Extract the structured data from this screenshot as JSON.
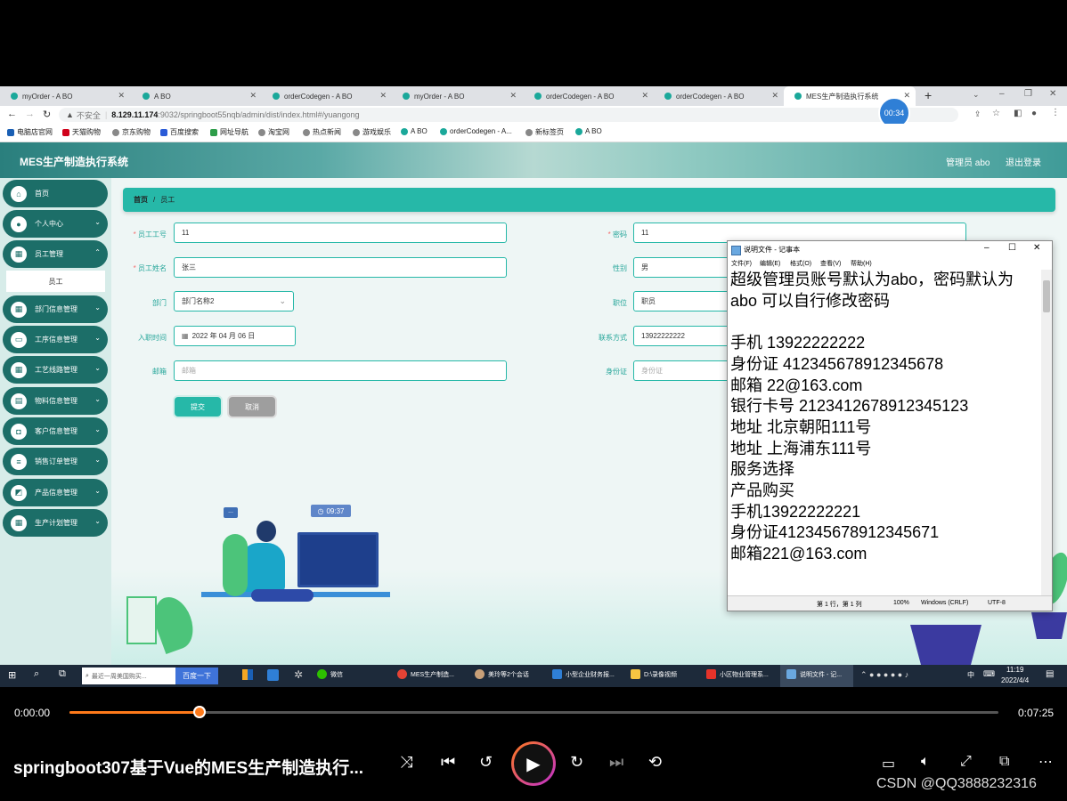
{
  "browser": {
    "tabs": [
      {
        "label": "myOrder - A BO"
      },
      {
        "label": "A BO"
      },
      {
        "label": "orderCodegen - A BO"
      },
      {
        "label": "myOrder - A BO"
      },
      {
        "label": "orderCodegen - A BO"
      },
      {
        "label": "orderCodegen - A BO"
      },
      {
        "label": "MES生产制造执行系统"
      }
    ],
    "new_tab": "+",
    "not_secure": "不安全",
    "url_host": "8.129.11.174",
    "url_rest": ":9032/springboot55nqb/admin/dist/index.html#/yuangong",
    "timer_badge": "00:34",
    "bookmarks": [
      "电脑店官网",
      "天猫购物",
      "京东购物",
      "百度搜索",
      "网址导航",
      "淘宝网",
      "热点新闻",
      "游戏娱乐",
      "A BO",
      "orderCodegen - A...",
      "新标签页",
      "A BO"
    ]
  },
  "app": {
    "title": "MES生产制造执行系统",
    "admin_label": "管理员 abo",
    "logout": "退出登录",
    "sidebar": {
      "items": [
        {
          "label": "首页",
          "icon": "home-icon",
          "glyph": "⌂"
        },
        {
          "label": "个人中心",
          "icon": "user-icon",
          "glyph": "●"
        },
        {
          "label": "员工管理",
          "icon": "grid-icon",
          "glyph": "▦"
        },
        {
          "label": "部门信息管理",
          "icon": "grid-icon",
          "glyph": "▦"
        },
        {
          "label": "工序信息管理",
          "icon": "monitor-icon",
          "glyph": "▭"
        },
        {
          "label": "工艺线路管理",
          "icon": "grid-icon",
          "glyph": "▦"
        },
        {
          "label": "物料信息管理",
          "icon": "clipboard-icon",
          "glyph": "▤"
        },
        {
          "label": "客户信息管理",
          "icon": "box-icon",
          "glyph": "◘"
        },
        {
          "label": "销售订单管理",
          "icon": "list-icon",
          "glyph": "≡"
        },
        {
          "label": "产品信息管理",
          "icon": "chart-icon",
          "glyph": "◩"
        },
        {
          "label": "生产计划管理",
          "icon": "grid-icon",
          "glyph": "▦"
        }
      ],
      "subitem": "员工"
    },
    "breadcrumb": {
      "home": "首页",
      "sep": "/",
      "current": "员工"
    },
    "form": {
      "emp_no": {
        "label": "员工工号",
        "value": "11"
      },
      "password": {
        "label": "密码",
        "value": "11"
      },
      "emp_name": {
        "label": "员工姓名",
        "value": "张三"
      },
      "gender": {
        "label": "性别",
        "value": "男"
      },
      "dept": {
        "label": "部门",
        "value": "部门名称2"
      },
      "position": {
        "label": "职位",
        "value": "职员"
      },
      "hire_date": {
        "label": "入职时间",
        "value": "2022 年 04 月 06 日"
      },
      "phone": {
        "label": "联系方式",
        "value": "13922222222"
      },
      "email": {
        "label": "邮箱",
        "placeholder": "邮箱"
      },
      "idcard": {
        "label": "身份证",
        "placeholder": "身份证"
      },
      "submit": "提交",
      "cancel": "取消"
    },
    "illustration_time": "09:37",
    "chat_bubble": "..."
  },
  "notepad": {
    "title": "说明文件 - 记事本",
    "menu": [
      "文件(F)",
      "编辑(E)",
      "格式(O)",
      "查看(V)",
      "帮助(H)"
    ],
    "content": "超级管理员账号默认为abo，密码默认为\nabo 可以自行修改密码\n\n手机 13922222222\n身份证 412345678912345678\n邮箱 22@163.com\n银行卡号 2123412678912345123\n地址 北京朝阳111号\n地址 上海浦东111号\n服务选择\n产品购买\n手机13922222221\n身份证412345678912345671\n邮箱221@163.com",
    "status": {
      "position": "第 1 行，第 1 列",
      "zoom": "100%",
      "eol": "Windows (CRLF)",
      "encoding": "UTF-8"
    }
  },
  "taskbar": {
    "search_placeholder": "最近一周美国购买...",
    "search_button": "百度一下",
    "apps": [
      "微信",
      "MES生产制造...",
      "美玲等2个会话",
      "小型企业财务报...",
      "D:\\录像视频",
      "小区物业管理系...",
      "说明文件 - 记..."
    ],
    "clock_time": "11:19",
    "clock_date": "2022/4/4",
    "ime": "中"
  },
  "player": {
    "current_time": "0:00:00",
    "total_time": "0:07:25",
    "progress": 0.14,
    "title": "springboot307基于Vue的MES生产制造执行...",
    "watermark": "CSDN @QQ3888232316",
    "colors": {
      "progress": "#ff7a1a",
      "play_ring_start": "#ff7a1a",
      "play_ring_end": "#c02fd0"
    }
  }
}
